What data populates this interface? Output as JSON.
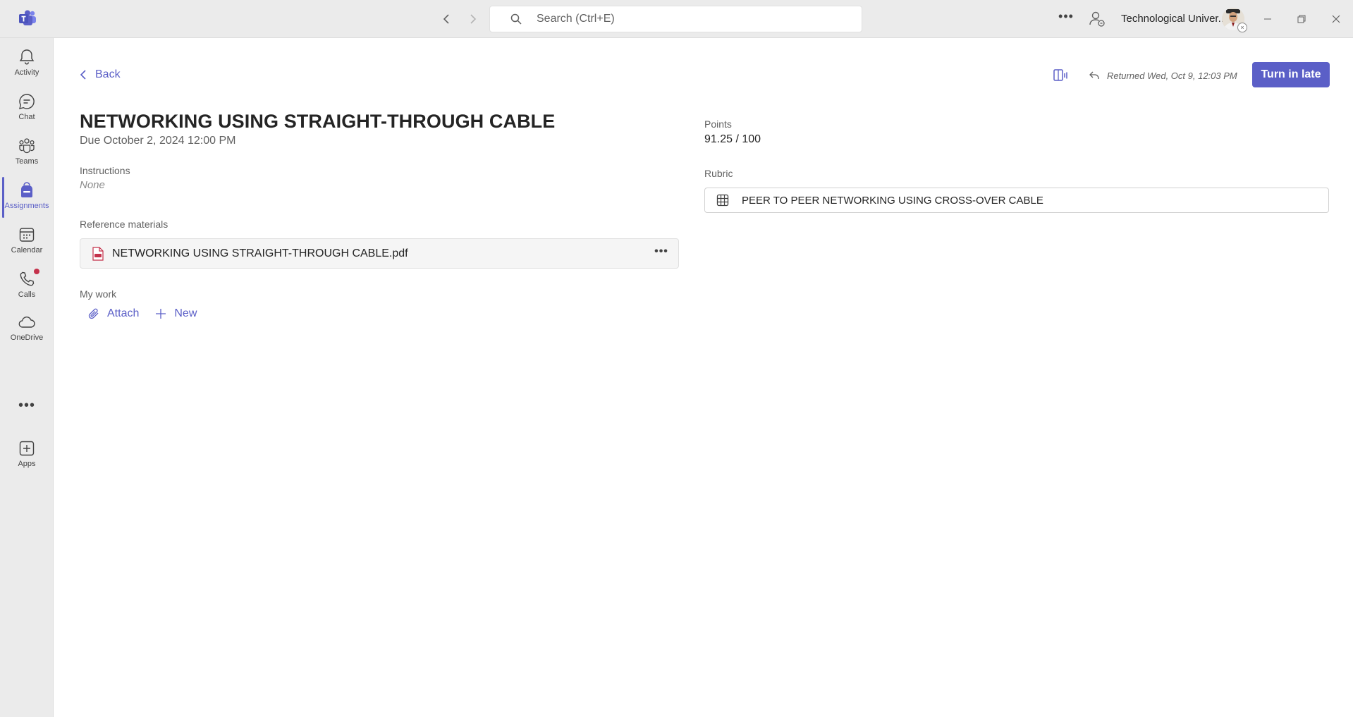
{
  "titlebar": {
    "search_placeholder": "Search (Ctrl+E)",
    "org_name": "Technological Univer..."
  },
  "rail": {
    "items": [
      {
        "label": "Activity",
        "icon": "bell-icon"
      },
      {
        "label": "Chat",
        "icon": "chat-icon"
      },
      {
        "label": "Teams",
        "icon": "teams-icon"
      },
      {
        "label": "Assignments",
        "icon": "backpack-icon",
        "active": true
      },
      {
        "label": "Calendar",
        "icon": "calendar-icon"
      },
      {
        "label": "Calls",
        "icon": "phone-icon",
        "badge": true
      },
      {
        "label": "OneDrive",
        "icon": "cloud-icon"
      },
      {
        "label": "Apps",
        "icon": "add-app-icon"
      }
    ],
    "more": "•••"
  },
  "header": {
    "back_label": "Back",
    "returned_text": "Returned Wed, Oct 9, 12:03 PM",
    "turn_in_label": "Turn in late"
  },
  "assignment": {
    "title": "NETWORKING USING STRAIGHT-THROUGH CABLE",
    "due": "Due October 2, 2024 12:00 PM",
    "instructions_label": "Instructions",
    "instructions_value": "None",
    "reference_label": "Reference materials",
    "reference_file": "NETWORKING USING STRAIGHT-THROUGH CABLE.pdf",
    "my_work_label": "My work",
    "attach_label": "Attach",
    "new_label": "New"
  },
  "grading": {
    "points_label": "Points",
    "points_value": "91.25 / 100",
    "rubric_label": "Rubric",
    "rubric_name": "PEER TO PEER NETWORKING USING CROSS-OVER CABLE"
  },
  "colors": {
    "accent": "#5b5fc7",
    "rail_bg": "#ebebeb",
    "badge_red": "#c4314b"
  }
}
